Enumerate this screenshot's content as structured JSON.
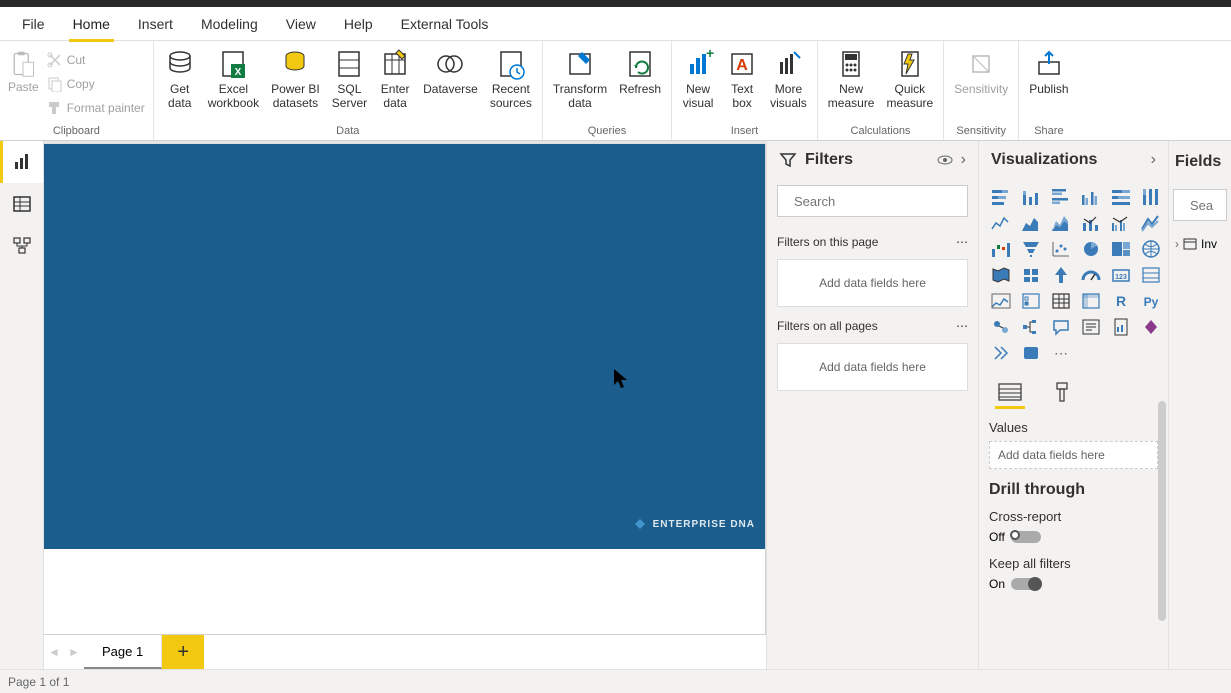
{
  "menubar": {
    "items": [
      "File",
      "Home",
      "Insert",
      "Modeling",
      "View",
      "Help",
      "External Tools"
    ],
    "active": 1
  },
  "ribbon": {
    "clipboard": {
      "label": "Clipboard",
      "paste": "Paste",
      "cut": "Cut",
      "copy": "Copy",
      "format_painter": "Format painter"
    },
    "data": {
      "label": "Data",
      "get_data": "Get\ndata",
      "excel": "Excel\nworkbook",
      "pbi_datasets": "Power BI\ndatasets",
      "sql_server": "SQL\nServer",
      "enter_data": "Enter\ndata",
      "dataverse": "Dataverse",
      "recent_sources": "Recent\nsources"
    },
    "queries": {
      "label": "Queries",
      "transform": "Transform\ndata",
      "refresh": "Refresh"
    },
    "insert": {
      "label": "Insert",
      "new_visual": "New\nvisual",
      "text_box": "Text\nbox",
      "more_visuals": "More\nvisuals"
    },
    "calculations": {
      "label": "Calculations",
      "new_measure": "New\nmeasure",
      "quick_measure": "Quick\nmeasure"
    },
    "sensitivity": {
      "label": "Sensitivity",
      "btn": "Sensitivity"
    },
    "share": {
      "label": "Share",
      "publish": "Publish"
    }
  },
  "filters": {
    "title": "Filters",
    "search_placeholder": "Search",
    "on_page": "Filters on this page",
    "on_all": "Filters on all pages",
    "add_fields": "Add data fields here"
  },
  "viz": {
    "title": "Visualizations",
    "values_label": "Values",
    "add_fields": "Add data fields here",
    "drill_title": "Drill through",
    "cross_report": "Cross-report",
    "cross_report_state": "Off",
    "keep_filters": "Keep all filters",
    "keep_filters_state": "On"
  },
  "fields": {
    "title": "Fields",
    "search_placeholder": "Sea",
    "tables": [
      "Inv"
    ]
  },
  "canvas": {
    "logo_text": "ENTERPRISE DNA"
  },
  "pages": {
    "tabs": [
      "Page 1"
    ]
  },
  "statusbar": {
    "text": "Page 1 of 1"
  }
}
